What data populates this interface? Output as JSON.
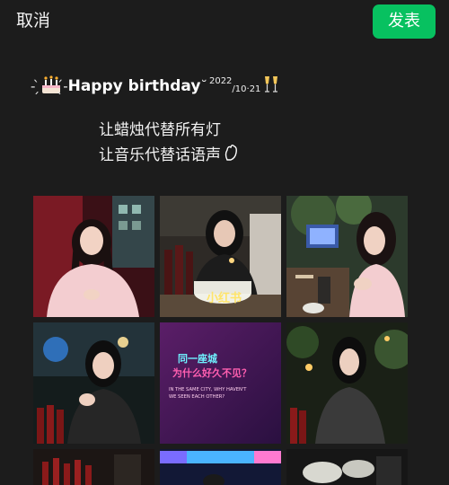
{
  "topbar": {
    "cancel_label": "取消",
    "publish_label": "发表"
  },
  "caption": {
    "deco_left": "- ̗̀",
    "deco_mid": " ̖́- ",
    "title": "Happy  birthday",
    "title_mark": "˘",
    "date_year": "2022",
    "date_rest": "/10·21",
    "line2": "让蜡烛代替所有灯",
    "line3": "让音乐代替话语声"
  },
  "photos": [
    {
      "label": "photo-1-woman-pink-coat"
    },
    {
      "label": "photo-2-woman-birthday-cake",
      "sticker": "小红书"
    },
    {
      "label": "photo-3-woman-pink-coat-cafe"
    },
    {
      "label": "photo-4-woman-dark-bar"
    },
    {
      "label": "photo-5-neon-sign",
      "neon_line1": "同一座城",
      "neon_line2": "为什么好久不见？",
      "neon_line3": "IN THE SAME CITY, WHY HAVEN'T",
      "neon_line4": "WE SEEN EACH OTHER?"
    },
    {
      "label": "photo-6-woman-black-coat"
    },
    {
      "label": "photo-7-bar-bottles"
    },
    {
      "label": "photo-8-neon-lights"
    },
    {
      "label": "photo-9-dim-table"
    }
  ],
  "colors": {
    "background": "#1c1c1c",
    "publish_button": "#07c160",
    "neon_pink": "#ff5fb0",
    "neon_cyan": "#6ff2ff"
  }
}
